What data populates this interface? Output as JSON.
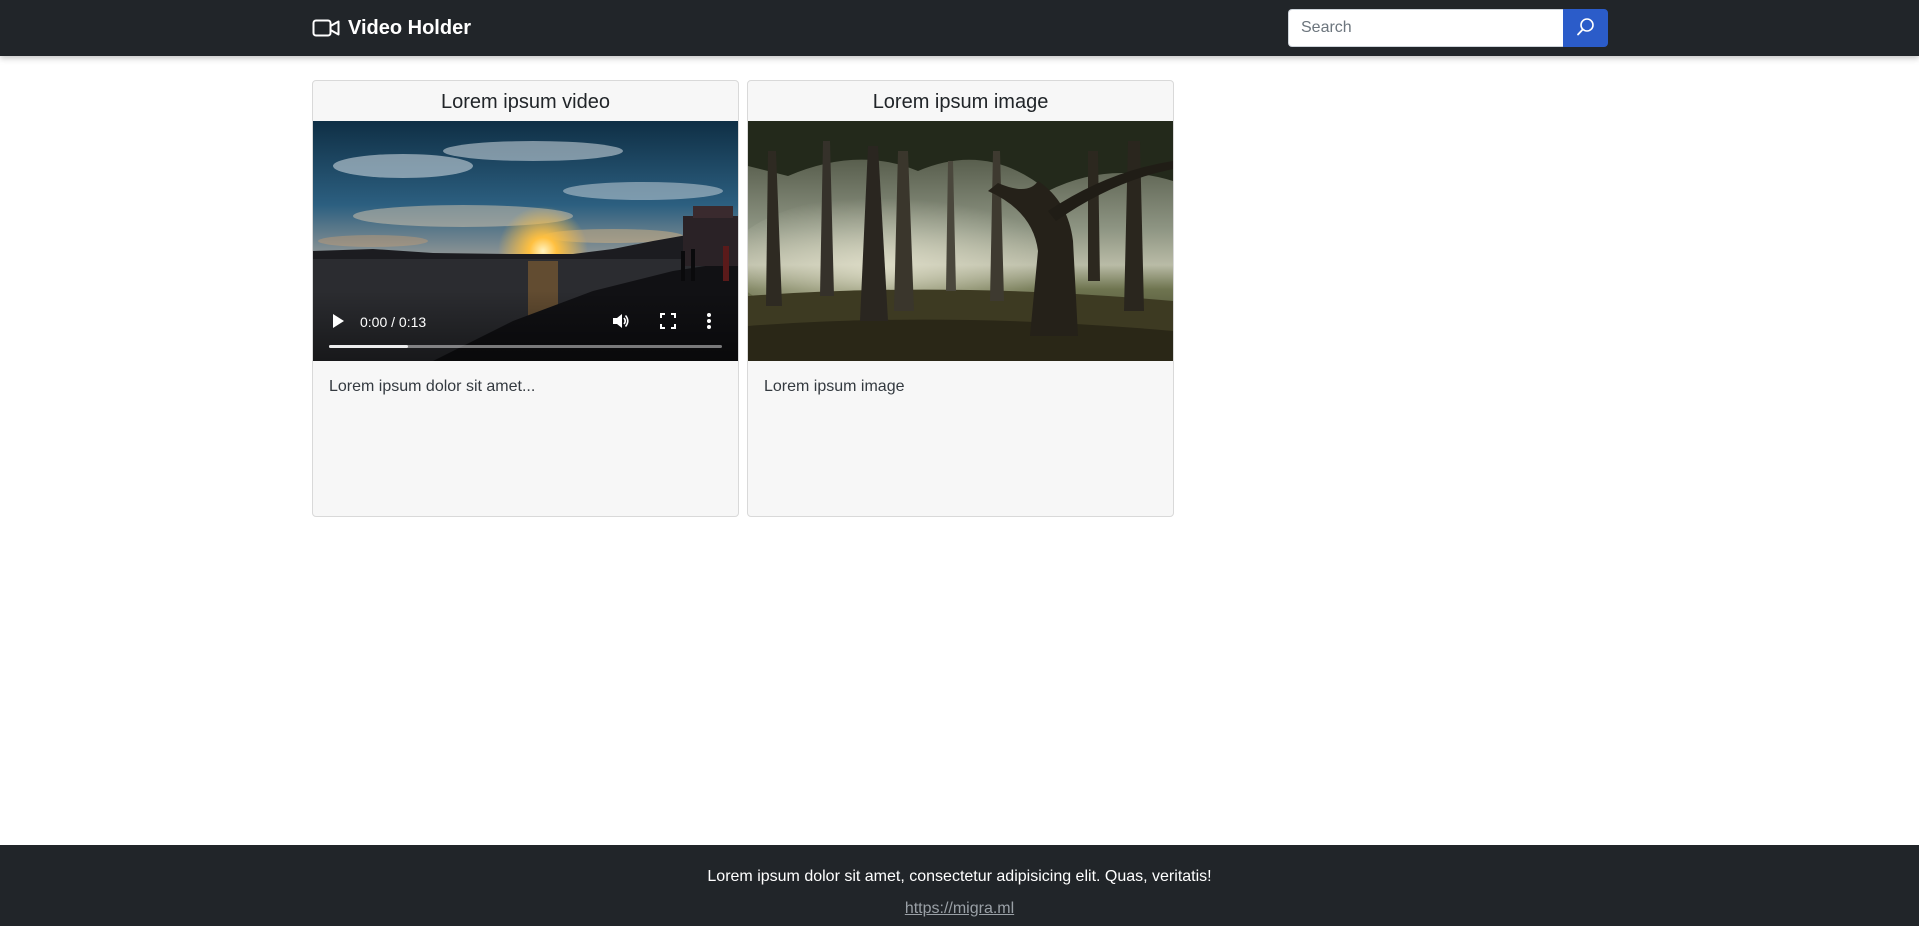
{
  "navbar": {
    "brand": "Video Holder",
    "brand_icon": "video-camera-icon",
    "search": {
      "placeholder": "Search",
      "value": "",
      "button_icon": "search-icon"
    },
    "colors": {
      "background": "#212529",
      "search_button": "#2b5cc9"
    }
  },
  "cards": [
    {
      "title": "Lorem ipsum video",
      "media_type": "video",
      "media_description": "sunset over sea",
      "text": "Lorem ipsum dolor sit amet...",
      "player": {
        "time": "0:00 / 0:13",
        "buffered_fraction": 0.2,
        "icons": [
          "play-icon",
          "volume-icon",
          "fullscreen-icon",
          "more-vertical-icon"
        ]
      }
    },
    {
      "title": "Lorem ipsum image",
      "media_type": "image",
      "media_description": "trees in misty forest",
      "text": "Lorem ipsum image"
    }
  ],
  "footer": {
    "text": "Lorem ipsum dolor sit amet, consectetur adipisicing elit. Quas, veritatis!",
    "link": "https://migra.ml"
  }
}
